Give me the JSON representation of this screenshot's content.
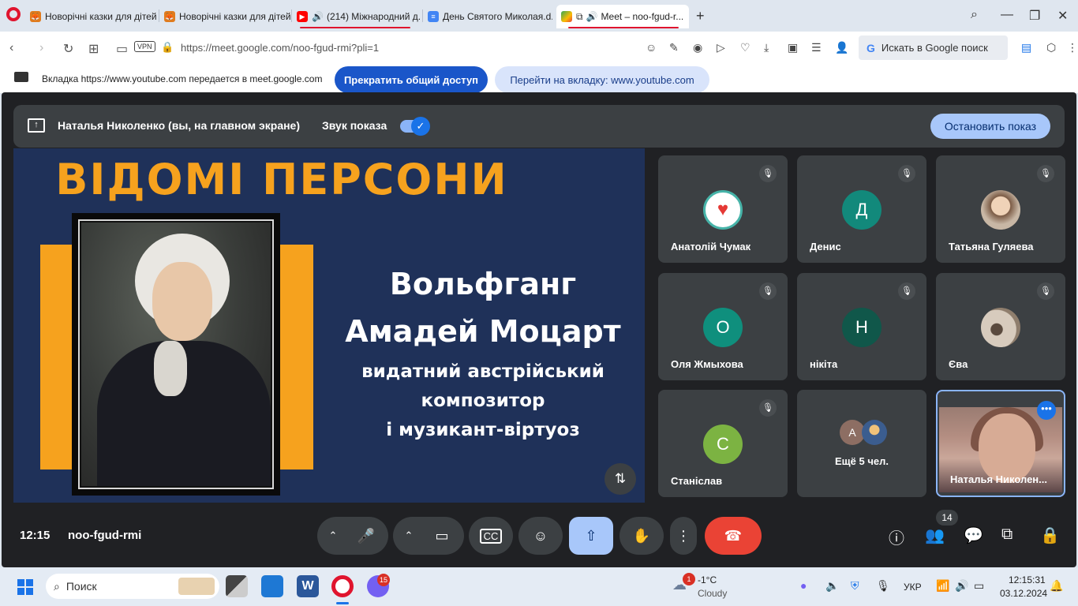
{
  "browser": {
    "tabs": [
      {
        "label": "Новорічні казки для дітей",
        "icon": "fox-icon",
        "muted": false
      },
      {
        "label": "Новорічні казки для дітей",
        "icon": "fox-icon",
        "muted": false
      },
      {
        "label": "(214) Міжнародний д...",
        "icon": "youtube-icon",
        "muted": false,
        "audio": true
      },
      {
        "label": "День Святого Миколая.d...",
        "icon": "docs-icon"
      },
      {
        "label": "Meet – noo-fgud-r...",
        "icon": "meet-icon",
        "active": true,
        "audio": true
      }
    ],
    "url": "https://meet.google.com/noo-fgud-rmi?pli=1",
    "vpn_label": "VPN",
    "search_placeholder": "Искать в Google поиск"
  },
  "sharebar": {
    "message": "Вкладка https://www.youtube.com передается в meet.google.com",
    "stop_label": "Прекратить общий доступ",
    "goto_label": "Перейти на вкладку: www.youtube.com"
  },
  "presentation": {
    "presenter": "Наталья Николенко (вы, на главном экране)",
    "sound_label": "Звук показа",
    "sound_on": true,
    "stop_label": "Остановить показ"
  },
  "slide": {
    "title": "ВІДОМІ ПЕРСОНИ",
    "name_line1": "Вольфганг",
    "name_line2": "Амадей Моцарт",
    "desc_line1": "видатний австрійський",
    "desc_line2": "композитор",
    "desc_line3": "і музикант-віртуоз"
  },
  "participants": [
    {
      "name": "Анатолій Чумак",
      "avatar": "asmr-heart-icon",
      "color": "#ffffff",
      "muted": true
    },
    {
      "name": "Денис",
      "initial": "Д",
      "color": "#12897b",
      "muted": true
    },
    {
      "name": "Татьяна Гуляева",
      "avatar": "photo",
      "color": "#c9a88b",
      "muted": true
    },
    {
      "name": "Оля Жмыхова",
      "initial": "О",
      "color": "#0f8f7d",
      "muted": true
    },
    {
      "name": "нікіта",
      "initial": "Н",
      "color": "#10574a",
      "muted": true
    },
    {
      "name": "Єва",
      "avatar": "photo",
      "color": "#b0a090",
      "muted": true
    },
    {
      "name": "Станіслав",
      "initial": "С",
      "color": "#7cb342",
      "muted": true
    },
    {
      "name": "Ещё 5 чел.",
      "mini_initial": "А"
    },
    {
      "name": "Наталья Николен...",
      "self": true
    }
  ],
  "meeting": {
    "time": "12:15",
    "code": "noo-fgud-rmi",
    "people_count": "14"
  },
  "taskbar": {
    "search_label": "Поиск",
    "viber_badge": "15",
    "weather_badge": "1",
    "weather_temp": "-1°C",
    "weather_desc": "Cloudy",
    "lang": "УКР",
    "clock_time": "12:15:31",
    "clock_date": "03.12.2024"
  },
  "colors": {
    "accent_blue": "#1a56c9",
    "meet_bg": "#202124",
    "slide_bg": "#1f3159",
    "slide_orange": "#f6a21e",
    "end_call_red": "#ea4335"
  }
}
